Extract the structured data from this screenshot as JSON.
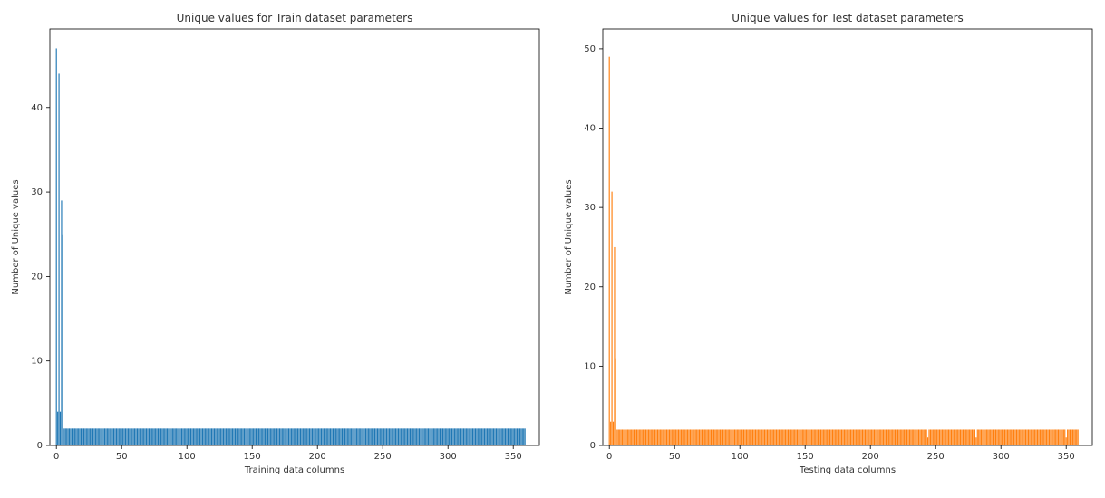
{
  "chart_data": [
    {
      "id": "train",
      "type": "bar",
      "title": "Unique values for Train dataset parameters",
      "xlabel": "Training data columns",
      "ylabel": "Number of Unique values",
      "color": "#1f77b4",
      "xlim": [
        -5,
        370
      ],
      "ylim": [
        0,
        49.3
      ],
      "x_ticks": [
        0,
        50,
        100,
        150,
        200,
        250,
        300,
        350
      ],
      "y_ticks": [
        0,
        10,
        20,
        30,
        40
      ],
      "n_bars": 360,
      "default_value": 2,
      "overrides": {
        "0": 47,
        "1": 4,
        "2": 44,
        "3": 4,
        "4": 29,
        "5": 25
      }
    },
    {
      "id": "test",
      "type": "bar",
      "title": "Unique values for Test dataset parameters",
      "xlabel": "Testing data columns",
      "ylabel": "Number of Unique values",
      "color": "#ff7f0e",
      "xlim": [
        -5,
        370
      ],
      "ylim": [
        0,
        52.5
      ],
      "x_ticks": [
        0,
        50,
        100,
        150,
        200,
        250,
        300,
        350
      ],
      "y_ticks": [
        0,
        10,
        20,
        30,
        40,
        50
      ],
      "n_bars": 360,
      "default_value": 2,
      "overrides": {
        "0": 49,
        "1": 3,
        "2": 32,
        "3": 3,
        "4": 25,
        "5": 11,
        "244": 1,
        "281": 1,
        "350": 1
      }
    }
  ]
}
